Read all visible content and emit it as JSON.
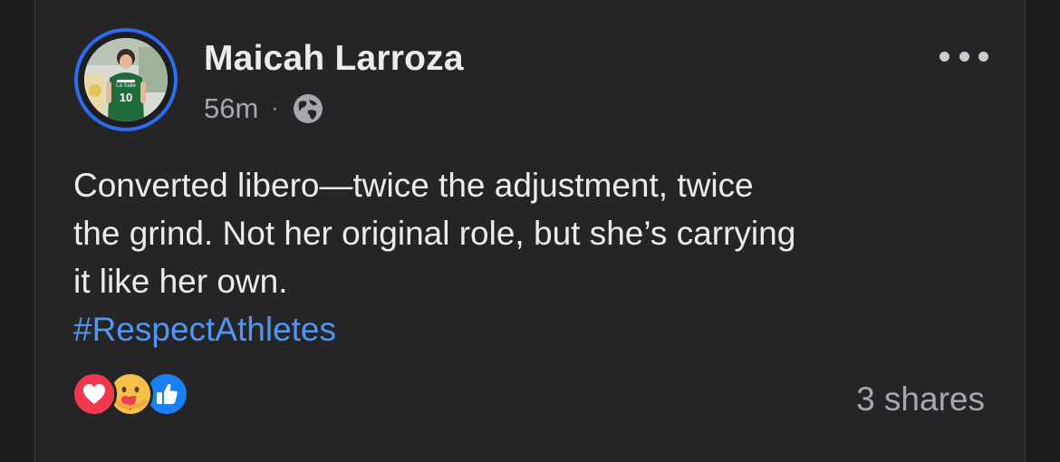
{
  "post": {
    "author_name": "Maicah Larroza",
    "time_ago": "56m",
    "separator": "·",
    "privacy_icon": "globe-icon",
    "more_icon": "more-horizontal-icon",
    "text_lines": [
      "Converted libero—twice the adjustment, twice",
      "the grind. Not her original role, but she’s carrying",
      "it like her own."
    ],
    "hashtag": "#RespectAthletes",
    "reactions": [
      "love-reaction-icon",
      "care-reaction-icon",
      "like-reaction-icon"
    ],
    "shares_label": "3 shares"
  },
  "colors": {
    "background": "#252527",
    "text": "#ececee",
    "secondary_text": "#a7a8ac",
    "hashtag": "#4f97f1",
    "story_ring": "#2d6cf0",
    "love": "#f0384f",
    "care": "#f7c04b",
    "like": "#1c7ff2"
  },
  "avatar": {
    "jersey_text": "La Salle",
    "jersey_number": "10"
  }
}
